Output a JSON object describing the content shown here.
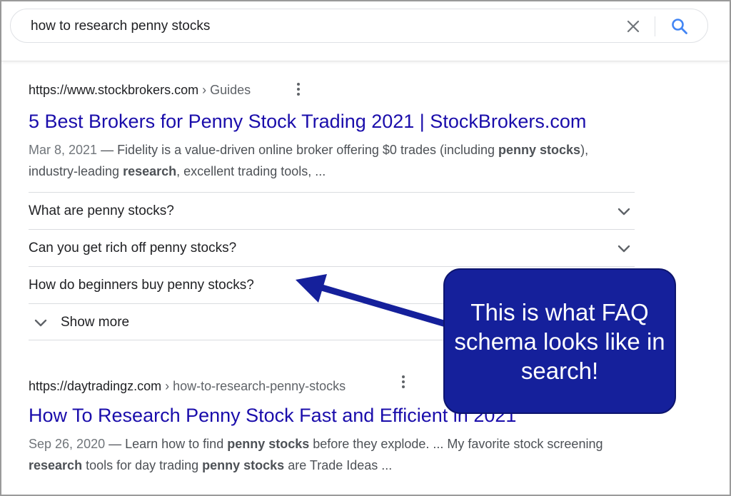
{
  "search": {
    "query": "how to research penny stocks",
    "clear_icon": "close-icon",
    "search_icon": "search-icon",
    "accent": "#4285f4"
  },
  "results": [
    {
      "url": "https://www.stockbrokers.com",
      "breadcrumb": " › Guides",
      "title": "5 Best Brokers for Penny Stock Trading 2021 | StockBrokers.com",
      "date": "Mar 8, 2021",
      "snippet": [
        {
          "t": " — Fidelity is a value-driven online broker offering $0 trades (including ",
          "b": false
        },
        {
          "t": "penny stocks",
          "b": true
        },
        {
          "t": "), industry-leading ",
          "b": false
        },
        {
          "t": "research",
          "b": true
        },
        {
          "t": ", excellent trading tools, ...",
          "b": false
        }
      ],
      "faq": [
        "What are penny stocks?",
        "Can you get rich off penny stocks?",
        "How do beginners buy penny stocks?"
      ],
      "show_more": "Show more"
    },
    {
      "url": "https://daytradingz.com",
      "breadcrumb": " › how-to-research-penny-stocks",
      "title": "How To Research Penny Stock Fast and Efficient in 2021",
      "date": "Sep 26, 2020",
      "snippet": [
        {
          "t": " — Learn how to find ",
          "b": false
        },
        {
          "t": "penny stocks",
          "b": true
        },
        {
          "t": " before they explode. ... My favorite stock screening ",
          "b": false
        },
        {
          "t": "research",
          "b": true
        },
        {
          "t": " tools for day trading ",
          "b": false
        },
        {
          "t": "penny stocks",
          "b": true
        },
        {
          "t": " are Trade Ideas ...",
          "b": false
        }
      ]
    }
  ],
  "callout": {
    "text": "This is what FAQ schema looks like in search!",
    "color": "#15209b"
  },
  "colors": {
    "link": "#1a0dab",
    "text": "#202124",
    "muted": "#4d5156"
  }
}
